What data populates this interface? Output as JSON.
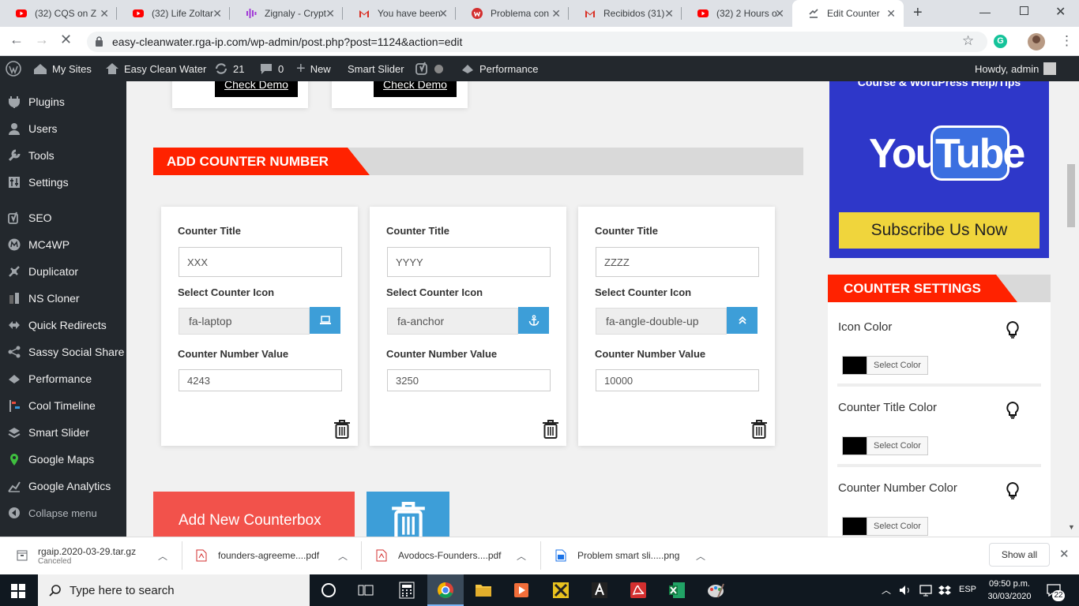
{
  "browser": {
    "tabs": [
      {
        "title": "(32) CQS on Z",
        "icon": "youtube-icon"
      },
      {
        "title": "(32) Life Zoltar",
        "icon": "youtube-icon"
      },
      {
        "title": "Zignaly - Crypt",
        "icon": "zignaly-icon"
      },
      {
        "title": "You have been",
        "icon": "gmail-icon"
      },
      {
        "title": "Problema con",
        "icon": "wpforo-icon"
      },
      {
        "title": "Recibidos (31)",
        "icon": "gmail-icon"
      },
      {
        "title": "(32) 2 Hours o",
        "icon": "youtube-icon"
      },
      {
        "title": "Edit Counter",
        "icon": "wordpress-icon",
        "active": true
      }
    ],
    "url": "easy-cleanwater.rga-ip.com/wp-admin/post.php?post=1124&action=edit"
  },
  "adminbar": {
    "my_sites": "My Sites",
    "site_name": "Easy Clean Water",
    "updates": "21",
    "comments": "0",
    "new": "New",
    "smart_slider": "Smart Slider",
    "performance": "Performance",
    "howdy": "Howdy, admin"
  },
  "sidebar": [
    {
      "label": "Plugins",
      "icon": "plugins-icon"
    },
    {
      "label": "Users",
      "icon": "users-icon"
    },
    {
      "label": "Tools",
      "icon": "tools-icon"
    },
    {
      "label": "Settings",
      "icon": "settings-icon"
    },
    {
      "label": "SEO",
      "icon": "yoast-icon"
    },
    {
      "label": "MC4WP",
      "icon": "mc4wp-icon"
    },
    {
      "label": "Duplicator",
      "icon": "duplicator-icon"
    },
    {
      "label": "NS Cloner",
      "icon": "cloner-icon"
    },
    {
      "label": "Quick Redirects",
      "icon": "redirect-icon"
    },
    {
      "label": "Sassy Social Share",
      "icon": "share-icon"
    },
    {
      "label": "Performance",
      "icon": "performance-icon"
    },
    {
      "label": "Cool Timeline",
      "icon": "timeline-icon"
    },
    {
      "label": "Smart Slider",
      "icon": "slider-icon"
    },
    {
      "label": "Google Maps",
      "icon": "map-pin-icon"
    },
    {
      "label": "Google Analytics",
      "icon": "analytics-icon"
    },
    {
      "label": "Collapse menu",
      "icon": "collapse-icon"
    }
  ],
  "demo": {
    "btn1": "Check Demo",
    "btn2": "Check Demo"
  },
  "section_title": "ADD COUNTER NUMBER",
  "counters": [
    {
      "title_label": "Counter Title",
      "title": "XXX",
      "icon_label": "Select Counter Icon",
      "icon": "fa-laptop",
      "icon_name": "laptop-icon",
      "value_label": "Counter Number Value",
      "value": "4243"
    },
    {
      "title_label": "Counter Title",
      "title": "YYYY",
      "icon_label": "Select Counter Icon",
      "icon": "fa-anchor",
      "icon_name": "anchor-icon",
      "value_label": "Counter Number Value",
      "value": "3250"
    },
    {
      "title_label": "Counter Title",
      "title": "ZZZZ",
      "icon_label": "Select Counter Icon",
      "icon": "fa-angle-double-up",
      "icon_name": "angle-double-up-icon",
      "value_label": "Counter Number Value",
      "value": "10000"
    }
  ],
  "add_button": "Add New Counterbox",
  "promo": {
    "top_text": "Course & WordPress Help/Tips",
    "youtube": "YouTube",
    "subscribe": "Subscribe Us Now"
  },
  "settings": {
    "title": "COUNTER SETTINGS",
    "items": [
      {
        "label": "Icon Color",
        "button": "Select Color",
        "color": "#000000"
      },
      {
        "label": "Counter Title Color",
        "button": "Select Color",
        "color": "#000000"
      },
      {
        "label": "Counter Number Color",
        "button": "Select Color",
        "color": "#000000"
      }
    ]
  },
  "downloads": [
    {
      "name": "rgaip.2020-03-29.tar.gz",
      "status": "Canceled"
    },
    {
      "name": "founders-agreeme....pdf"
    },
    {
      "name": "Avodocs-Founders....pdf"
    },
    {
      "name": "Problem smart sli.....png"
    }
  ],
  "show_all": "Show all",
  "taskbar": {
    "search": "Type here to search",
    "lang": "ESP",
    "time": "09:50 p.m.",
    "date": "30/03/2020",
    "notifications": "22"
  },
  "colors": {
    "accent_red": "#ff2200",
    "blue": "#3d9ed8",
    "wp_dark": "#23282d",
    "promo_blue": "#2e37c9",
    "subscribe_yellow": "#f0d53c",
    "add_btn": "#f2524b"
  }
}
